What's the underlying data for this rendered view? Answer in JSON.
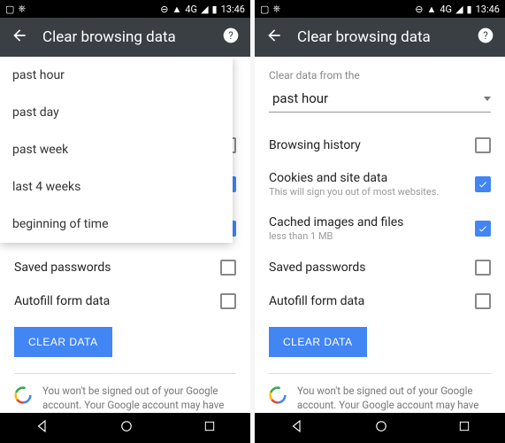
{
  "status": {
    "time": "13:46",
    "signal": "4G"
  },
  "header": {
    "title": "Clear browsing data"
  },
  "section_label": "Clear data from the",
  "dropdown": {
    "selected": "past hour",
    "options": [
      "past hour",
      "past day",
      "past week",
      "last 4 weeks",
      "beginning of time"
    ]
  },
  "items": [
    {
      "title": "Browsing history",
      "sub": "",
      "checked": false
    },
    {
      "title": "Cookies and site data",
      "sub": "This will sign you out of most websites.",
      "checked": true
    },
    {
      "title": "Cached images and files",
      "sub": "less than 1 MB",
      "checked": true
    },
    {
      "title": "Saved passwords",
      "sub": "",
      "checked": false
    },
    {
      "title": "Autofill form data",
      "sub": "",
      "checked": false
    }
  ],
  "clear_button": "CLEAR DATA",
  "info_text": "You won't be signed out of your Google account. Your Google account may have other forms of browsing history at"
}
